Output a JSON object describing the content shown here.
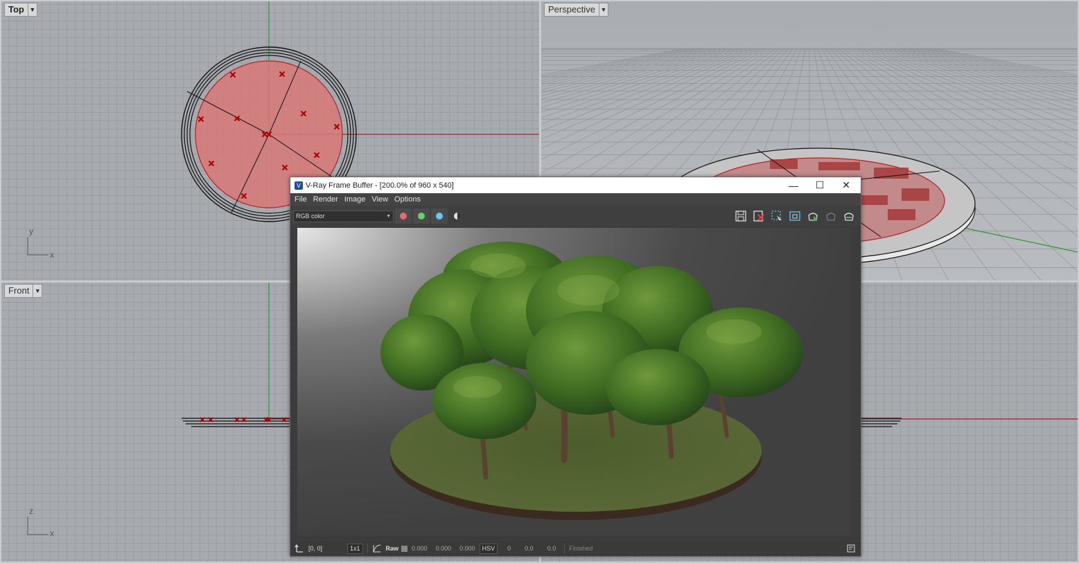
{
  "viewports": {
    "top": {
      "label": "Top",
      "axis_y": "y",
      "axis_x": "x"
    },
    "perspective": {
      "label": "Perspective"
    },
    "front": {
      "label": "Front",
      "axis_y": "z",
      "axis_x": "x"
    }
  },
  "vfb": {
    "title": "V-Ray Frame Buffer - [200.0% of 960 x 540]",
    "app_icon": "V",
    "menu": [
      "File",
      "Render",
      "Image",
      "View",
      "Options"
    ],
    "channel": "RGB color",
    "toolbar_icons": [
      "save-icon",
      "clear-icon",
      "region-select-icon",
      "follow-mouse-icon",
      "render-teapot-icon",
      "interactive-render-icon",
      "stop-render-icon"
    ],
    "status": {
      "coords": "[0, 0]",
      "sample": "1x1",
      "raw_label": "Raw",
      "r": "0.000",
      "g": "0.000",
      "b": "0.000",
      "color_mode": "HSV",
      "h": "0",
      "s": "0.0",
      "v": "0.0",
      "state": "Finished"
    }
  },
  "colors": {
    "grid_bg": "#a7abb0",
    "red_axis": "#b52020",
    "green_axis": "#2a9a2a",
    "plate_fill": "#d87878",
    "vfb_bg": "#3c3c3c"
  }
}
